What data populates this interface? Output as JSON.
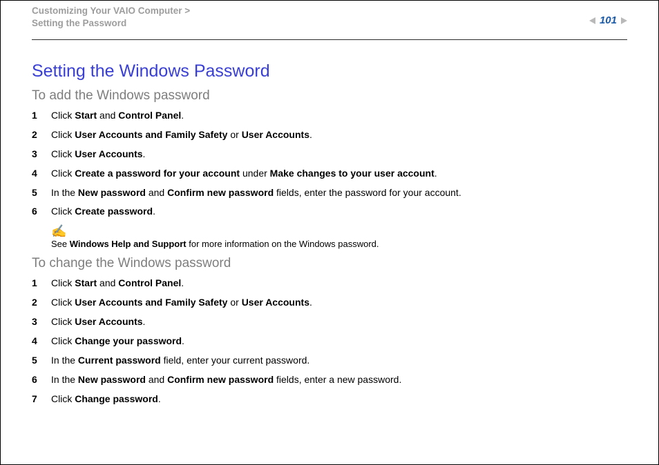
{
  "header": {
    "breadcrumb_line1": "Customizing Your VAIO Computer >",
    "breadcrumb_line2": "Setting the Password",
    "page_number": "101"
  },
  "title": "Setting the Windows Password",
  "section_a": {
    "heading": "To add the Windows password",
    "steps": [
      {
        "n": "1",
        "pre": "Click ",
        "b1": "Start",
        "mid": " and ",
        "b2": "Control Panel",
        "post": "."
      },
      {
        "n": "2",
        "pre": "Click ",
        "b1": "User Accounts and Family Safety",
        "mid": " or ",
        "b2": "User Accounts",
        "post": "."
      },
      {
        "n": "3",
        "pre": "Click ",
        "b1": "User Accounts",
        "mid": "",
        "b2": "",
        "post": "."
      },
      {
        "n": "4",
        "pre": "Click ",
        "b1": "Create a password for your account",
        "mid": " under ",
        "b2": "Make changes to your user account",
        "post": "."
      },
      {
        "n": "5",
        "pre": "In the ",
        "b1": "New password",
        "mid": " and ",
        "b2": "Confirm new password",
        "post": " fields, enter the password for your account."
      },
      {
        "n": "6",
        "pre": "Click ",
        "b1": "Create password",
        "mid": "",
        "b2": "",
        "post": "."
      }
    ]
  },
  "note": {
    "icon": "✍",
    "pre": "See ",
    "bold": "Windows Help and Support",
    "post": " for more information on the Windows password."
  },
  "section_b": {
    "heading": "To change the Windows password",
    "steps": [
      {
        "n": "1",
        "pre": "Click ",
        "b1": "Start",
        "mid": " and ",
        "b2": "Control Panel",
        "post": "."
      },
      {
        "n": "2",
        "pre": "Click ",
        "b1": "User Accounts and Family Safety",
        "mid": " or ",
        "b2": "User Accounts",
        "post": "."
      },
      {
        "n": "3",
        "pre": "Click ",
        "b1": "User Accounts",
        "mid": "",
        "b2": "",
        "post": "."
      },
      {
        "n": "4",
        "pre": "Click ",
        "b1": "Change your password",
        "mid": "",
        "b2": "",
        "post": "."
      },
      {
        "n": "5",
        "pre": "In the ",
        "b1": "Current password",
        "mid": "",
        "b2": "",
        "post": " field, enter your current password."
      },
      {
        "n": "6",
        "pre": "In the ",
        "b1": "New password",
        "mid": " and ",
        "b2": "Confirm new password",
        "post": " fields, enter a new password."
      },
      {
        "n": "7",
        "pre": "Click ",
        "b1": "Change password",
        "mid": "",
        "b2": "",
        "post": "."
      }
    ]
  }
}
